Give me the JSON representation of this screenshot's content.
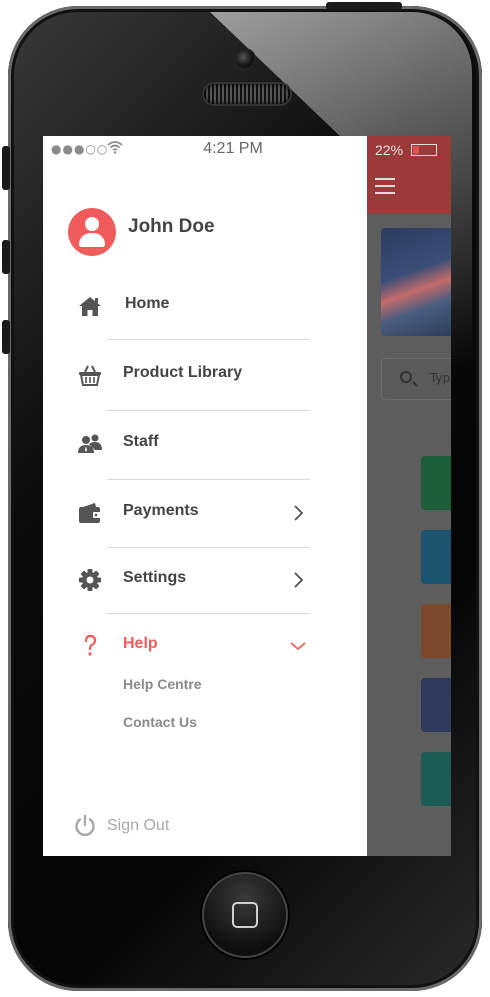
{
  "status_bar": {
    "signal": "●●●○○",
    "wifi_icon": "wifi-icon",
    "time": "4:21 PM"
  },
  "background_app": {
    "battery": "22%",
    "search_placeholder": "Typ",
    "tile_colors": [
      "#1e8a45",
      "#1f7ca8",
      "#c86a2e",
      "#3b4a7c",
      "#1f8a7c"
    ]
  },
  "user": {
    "name": "John Doe",
    "avatar_icon": "user-icon",
    "avatar_color": "#f05b5b"
  },
  "menu": {
    "items": [
      {
        "label": "Home",
        "icon": "home-icon"
      },
      {
        "label": "Product Library",
        "icon": "basket-icon"
      },
      {
        "label": "Staff",
        "icon": "staff-icon"
      },
      {
        "label": "Payments",
        "icon": "wallet-icon",
        "has_submenu": true
      },
      {
        "label": "Settings",
        "icon": "gear-icon",
        "has_submenu": true
      },
      {
        "label": "Help",
        "icon": "question-icon",
        "expanded": true,
        "active": true
      }
    ],
    "help_submenu": [
      "Help Centre",
      "Contact Us"
    ]
  },
  "signout": {
    "label": "Sign Out",
    "icon": "power-icon"
  },
  "colors": {
    "accent": "#f05b5b",
    "text": "#444444",
    "muted": "#8a8a8a"
  }
}
